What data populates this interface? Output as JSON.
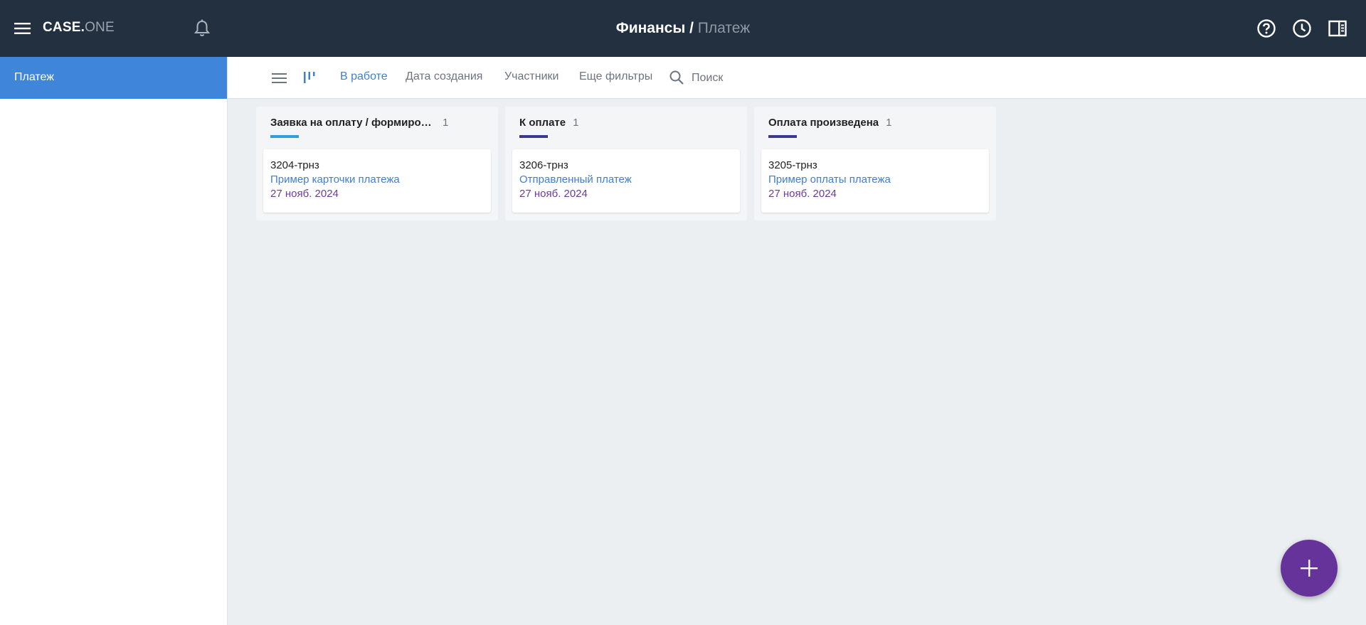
{
  "app": {
    "logo_main": "CASE.",
    "logo_sub": "ONE",
    "breadcrumb_root": "Финансы",
    "breadcrumb_sep": " / ",
    "breadcrumb_current": "Платеж"
  },
  "sidebar": {
    "items": [
      {
        "label": "Платеж",
        "active": true
      }
    ]
  },
  "toolbar": {
    "filters": [
      {
        "label": "В работе",
        "active": true
      },
      {
        "label": "Дата создания",
        "active": false
      },
      {
        "label": "Участники",
        "active": false
      },
      {
        "label": "Еще фильтры",
        "active": false
      }
    ],
    "search_placeholder": "Поиск"
  },
  "board": {
    "columns": [
      {
        "title": "Заявка на оплату / формирование",
        "count": "1",
        "color": "#2f9fe0",
        "cards": [
          {
            "id": "3204-трнз",
            "title": "Пример карточки платежа",
            "date": "27 нояб. 2024"
          }
        ]
      },
      {
        "title": "К оплате",
        "count": "1",
        "color": "#3a3a8c",
        "cards": [
          {
            "id": "3206-трнз",
            "title": "Отправленный платеж",
            "date": "27 нояб. 2024"
          }
        ]
      },
      {
        "title": "Оплата произведена",
        "count": "1",
        "color": "#3a3a8c",
        "cards": [
          {
            "id": "3205-трнз",
            "title": "Пример оплаты платежа",
            "date": "27 нояб. 2024"
          }
        ]
      }
    ]
  },
  "colors": {
    "topbar": "#223040",
    "accent": "#3f85d9",
    "fab": "#66339a"
  },
  "icons": {
    "menu": "menu-icon",
    "bell": "bell-icon",
    "help": "help-icon",
    "history": "clock-icon",
    "panel": "side-panel-icon",
    "list_view": "list-view-icon",
    "kanban_view": "kanban-view-icon",
    "search": "search-icon",
    "add": "plus-icon"
  }
}
